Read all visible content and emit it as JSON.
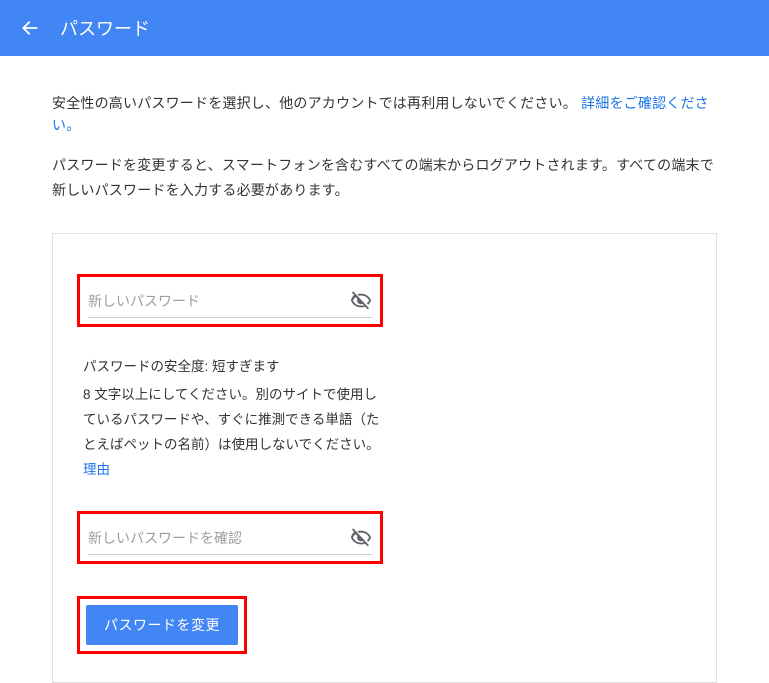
{
  "header": {
    "title": "パスワード"
  },
  "intro": {
    "line1_pre": "安全性の高いパスワードを選択し、他のアカウントでは再利用しないでください。",
    "line1_link": "詳細をご確認ください。",
    "line2": "パスワードを変更すると、スマートフォンを含むすべての端末からログアウトされます。すべての端末で新しいパスワードを入力する必要があります。"
  },
  "form": {
    "new_password_placeholder": "新しいパスワード",
    "confirm_password_placeholder": "新しいパスワードを確認",
    "strength_label_prefix": "パスワードの安全度: ",
    "strength_value": "短すぎます",
    "strength_hint_pre": "8 文字以上にしてください。別のサイトで使用しているパスワードや、すぐに推測できる単語（たとえばペットの名前）は使用しないでください。",
    "strength_hint_link": "理由",
    "submit_label": "パスワードを変更"
  }
}
